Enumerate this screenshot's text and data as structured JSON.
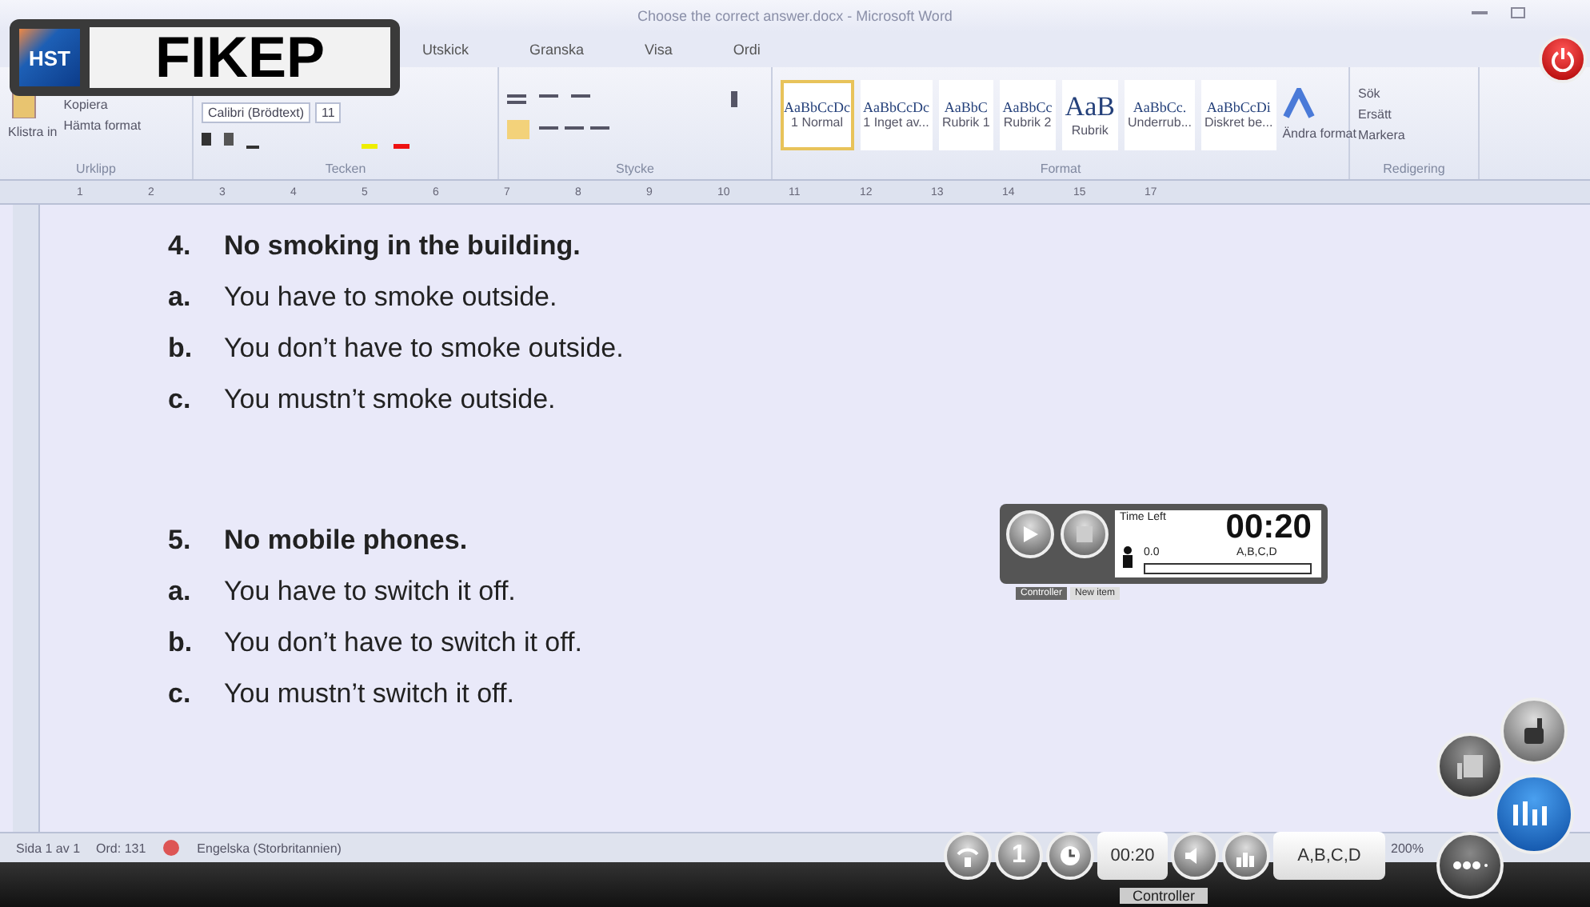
{
  "window": {
    "title": "Choose the correct answer.docx - Microsoft Word"
  },
  "tabs": [
    {
      "label": "Utskick",
      "selected": false
    },
    {
      "label": "Granska",
      "selected": false
    },
    {
      "label": "Visa",
      "selected": false
    },
    {
      "label": "Ordi",
      "selected": false
    }
  ],
  "ribbon": {
    "clipboard": {
      "paste": "Klistra in",
      "copy": "Kopiera",
      "format_painter": "Hämta format",
      "label": "Urklipp"
    },
    "font": {
      "name": "Calibri (Brödtext)",
      "size": "11",
      "label": "Tecken"
    },
    "paragraph": {
      "label": "Stycke"
    },
    "styles": {
      "items": [
        {
          "preview": "AaBbCcDc",
          "name": "1 Normal",
          "selected": true
        },
        {
          "preview": "AaBbCcDc",
          "name": "1 Inget av...",
          "selected": false
        },
        {
          "preview": "AaBbC",
          "name": "Rubrik 1",
          "selected": false
        },
        {
          "preview": "AaBbCc",
          "name": "Rubrik 2",
          "selected": false
        },
        {
          "preview": "AaB",
          "name": "Rubrik",
          "selected": false
        },
        {
          "preview": "AaBbCc.",
          "name": "Underrub...",
          "selected": false
        },
        {
          "preview": "AaBbCcDi",
          "name": "Diskret be...",
          "selected": false
        }
      ],
      "change": "Ändra format",
      "label": "Format"
    },
    "editing": {
      "find": "Sök",
      "replace": "Ersätt",
      "select": "Markera",
      "label": "Redigering"
    }
  },
  "ruler": [
    "1",
    "2",
    "3",
    "4",
    "5",
    "6",
    "7",
    "8",
    "9",
    "10",
    "11",
    "12",
    "13",
    "14",
    "15",
    "17"
  ],
  "questions": [
    {
      "number": "4.",
      "text": "No smoking in the building.",
      "options": [
        {
          "letter": "a.",
          "text": "You have to smoke outside."
        },
        {
          "letter": "b.",
          "text": "You don’t have to smoke outside."
        },
        {
          "letter": "c.",
          "text": "You mustn’t smoke outside."
        }
      ]
    },
    {
      "number": "5.",
      "text": "No mobile phones.",
      "options": [
        {
          "letter": "a.",
          "text": "You have to switch it off."
        },
        {
          "letter": "b.",
          "text": "You don’t have to switch it off."
        },
        {
          "letter": "c.",
          "text": "You mustn’t switch it off."
        }
      ]
    }
  ],
  "status_bar": {
    "page": "Sida 1 av 1",
    "words": "Ord: 131",
    "language": "Engelska (Storbritannien)",
    "zoom": "200%"
  },
  "banner": {
    "logo": "HST",
    "title": "FIKEP"
  },
  "timer": {
    "label": "Time Left",
    "time": "00:20",
    "count": "0.0",
    "answers": "A,B,C,D",
    "level": 0,
    "tabs": [
      {
        "label": "Controller",
        "selected": true
      },
      {
        "label": "New item",
        "selected": false
      }
    ]
  },
  "controller": {
    "question_number": "1",
    "time": "00:20",
    "answers": "A,B,C,D",
    "label": "Controller"
  }
}
